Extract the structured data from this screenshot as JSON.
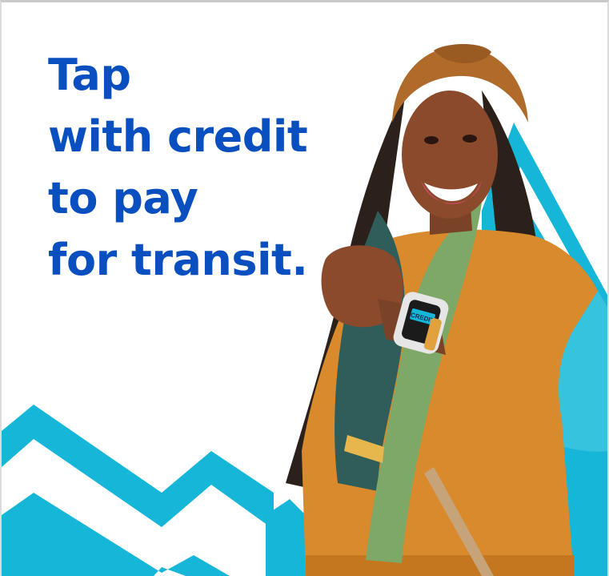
{
  "ad": {
    "headline_lines": [
      "Tap",
      "with credit",
      "to pay",
      "for transit."
    ],
    "watch_screen_text": "CREDIT"
  },
  "colors": {
    "brand_blue": "#0a4fbf",
    "accent_cyan": "#16b6d9",
    "background": "#ffffff",
    "sweater_orange": "#d98a2c",
    "shirt_turquoise": "#35c3dd",
    "headband_brown": "#b06a2a",
    "scarf_teal": "#2f5e5a",
    "scarf_sage": "#7ea867"
  },
  "icons": [
    "smartwatch-icon"
  ]
}
